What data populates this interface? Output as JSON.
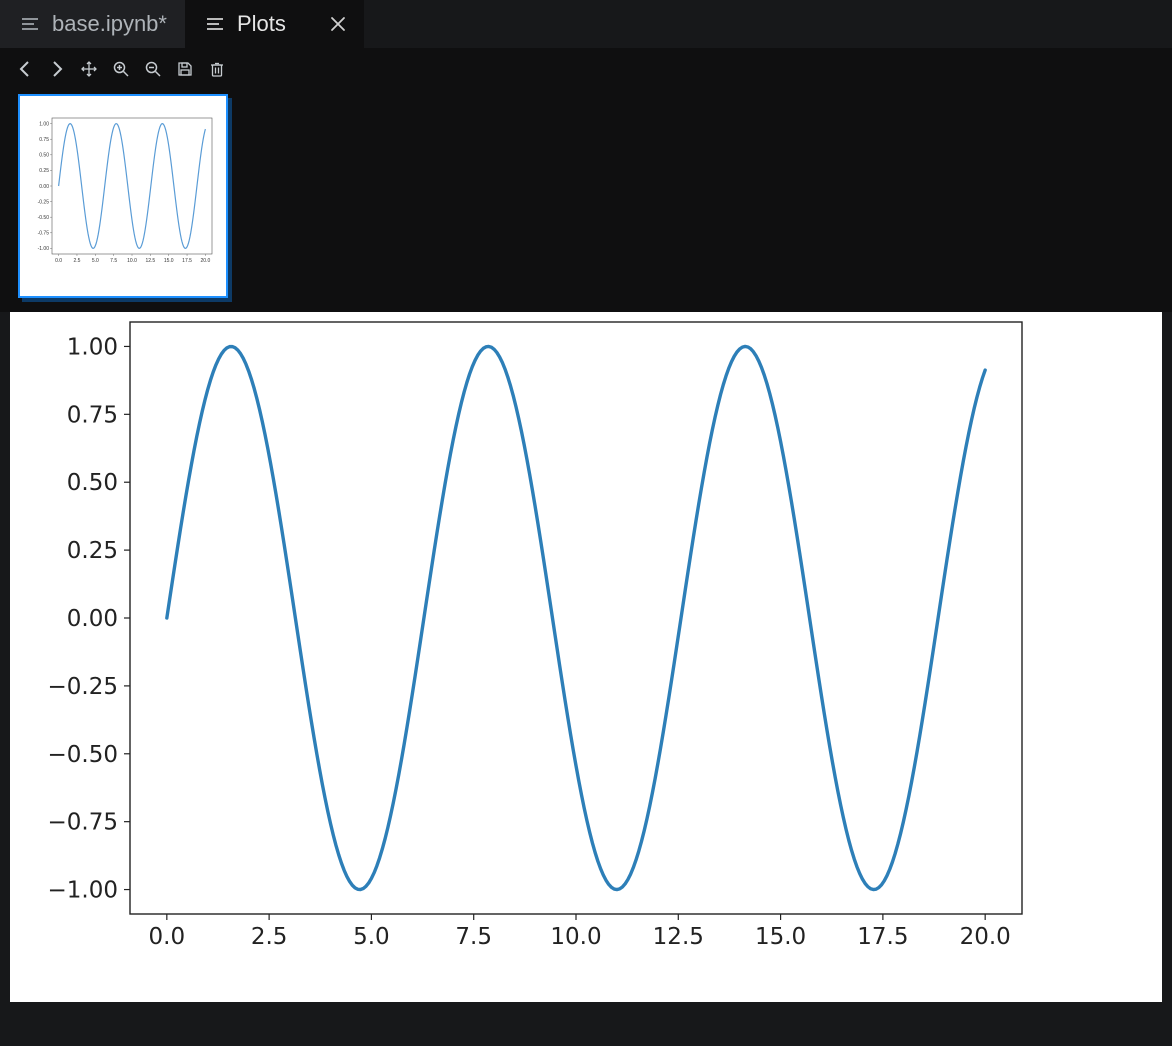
{
  "tabs": [
    {
      "label": "base.ipynb*",
      "active": false,
      "closable": false
    },
    {
      "label": "Plots",
      "active": true,
      "closable": true
    }
  ],
  "toolbar": {
    "prev": "previous-plot",
    "next": "next-plot",
    "pan": "pan",
    "zoom_in": "zoom-in",
    "zoom_out": "zoom-out",
    "save": "save",
    "delete": "delete"
  },
  "chart_data": {
    "type": "line",
    "function": "sin(x)",
    "x_range": [
      0,
      20
    ],
    "y_range": [
      -1.0,
      1.0
    ],
    "x_ticks": [
      "0.0",
      "2.5",
      "5.0",
      "7.5",
      "10.0",
      "12.5",
      "15.0",
      "17.5",
      "20.0"
    ],
    "y_ticks": [
      "1.00",
      "0.75",
      "0.50",
      "0.25",
      "0.00",
      "−0.25",
      "−0.50",
      "−0.75",
      "−1.00"
    ],
    "y_tick_values": [
      1.0,
      0.75,
      0.5,
      0.25,
      0.0,
      -0.25,
      -0.5,
      -0.75,
      -1.0
    ],
    "x_tick_values": [
      0.0,
      2.5,
      5.0,
      7.5,
      10.0,
      12.5,
      15.0,
      17.5,
      20.0
    ],
    "title": "",
    "xlabel": "",
    "ylabel": "",
    "line_color": "#2d7fb8",
    "n_points": 300
  },
  "thumbnail": {
    "selected": true,
    "x_ticks": [
      "0.0",
      "2.5",
      "5.0",
      "7.5",
      "10.0",
      "12.5",
      "15.0",
      "17.5",
      "20.0"
    ],
    "y_ticks": [
      "1.00",
      "0.75",
      "0.50",
      "0.25",
      "0.00",
      "-0.25",
      "-0.50",
      "-0.75",
      "-1.00"
    ]
  }
}
